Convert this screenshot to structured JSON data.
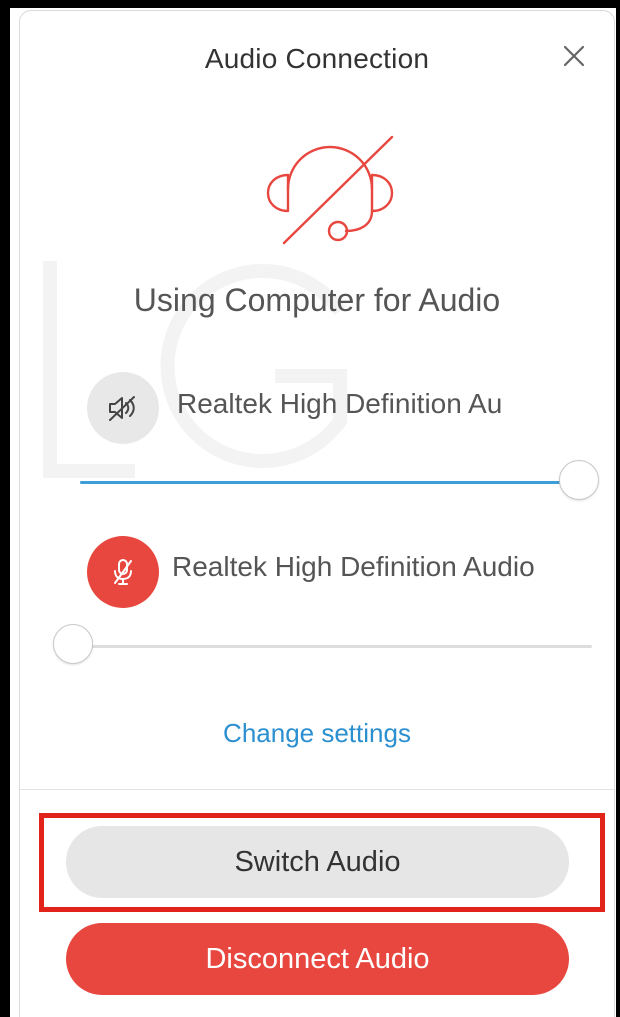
{
  "dialog": {
    "title": "Audio Connection",
    "status_text": "Using Computer for Audio",
    "close_icon": "close-icon",
    "headset_icon": "headset-muted-icon"
  },
  "speaker": {
    "device_name": "Realtek High Definition Au",
    "icon": "speaker-muted-icon",
    "volume_percent": 100
  },
  "microphone": {
    "device_name": "Realtek High Definition Audio",
    "icon": "microphone-muted-icon",
    "volume_percent": 0
  },
  "links": {
    "change_settings": "Change settings"
  },
  "actions": {
    "switch_audio": "Switch Audio",
    "disconnect_audio": "Disconnect Audio"
  },
  "colors": {
    "accent_blue": "#2b8fd0",
    "slider_fill": "#3d9ed8",
    "danger_red": "#e8473f",
    "highlight_red": "#e2231a",
    "neutral_button": "#e6e6e6"
  }
}
